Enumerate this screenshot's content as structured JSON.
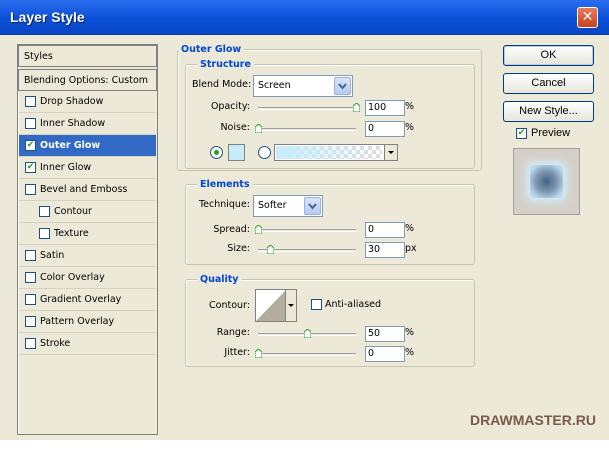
{
  "window": {
    "title": "Layer Style",
    "close_glyph": "✕"
  },
  "styles_list": {
    "header": "Styles",
    "blending": "Blending Options: Custom",
    "items": [
      {
        "label": "Drop Shadow",
        "checked": false
      },
      {
        "label": "Inner Shadow",
        "checked": false
      },
      {
        "label": "Outer Glow",
        "checked": true,
        "selected": true
      },
      {
        "label": "Inner Glow",
        "checked": true
      },
      {
        "label": "Bevel and Emboss",
        "checked": false
      },
      {
        "label": "Contour",
        "checked": false,
        "indent": true
      },
      {
        "label": "Texture",
        "checked": false,
        "indent": true
      },
      {
        "label": "Satin",
        "checked": false
      },
      {
        "label": "Color Overlay",
        "checked": false
      },
      {
        "label": "Gradient Overlay",
        "checked": false
      },
      {
        "label": "Pattern Overlay",
        "checked": false
      },
      {
        "label": "Stroke",
        "checked": false
      }
    ]
  },
  "panel": {
    "title": "Outer Glow"
  },
  "structure": {
    "legend": "Structure",
    "blend_mode_label": "Blend Mode:",
    "blend_mode_value": "Screen",
    "opacity_label": "Opacity:",
    "opacity_value": "100",
    "opacity_unit": "%",
    "opacity_level": 1.0,
    "noise_label": "Noise:",
    "noise_value": "0",
    "noise_unit": "%",
    "noise_level": 0,
    "glow_color": "#c6ecfa",
    "color_radio_selected": true
  },
  "elements": {
    "legend": "Elements",
    "technique_label": "Technique:",
    "technique_value": "Softer",
    "spread_label": "Spread:",
    "spread_value": "0",
    "spread_unit": "%",
    "spread_level": 0,
    "size_label": "Size:",
    "size_value": "30",
    "size_unit": "px",
    "size_level": 0.12
  },
  "quality": {
    "legend": "Quality",
    "contour_label": "Contour:",
    "antialiased_label": "Anti-aliased",
    "antialiased_checked": false,
    "range_label": "Range:",
    "range_value": "50",
    "range_unit": "%",
    "range_level": 0.5,
    "jitter_label": "Jitter:",
    "jitter_value": "0",
    "jitter_unit": "%",
    "jitter_level": 0
  },
  "buttons": {
    "ok": "OK",
    "cancel": "Cancel",
    "new_style": "New Style..."
  },
  "preview": {
    "label": "Preview",
    "checked": true
  },
  "watermark": {
    "text": "DRAWMASTER.RU"
  },
  "colors": {
    "accent": "#316ac5",
    "legend_blue": "#0046d5",
    "titlebar": "#0a4fd6"
  }
}
